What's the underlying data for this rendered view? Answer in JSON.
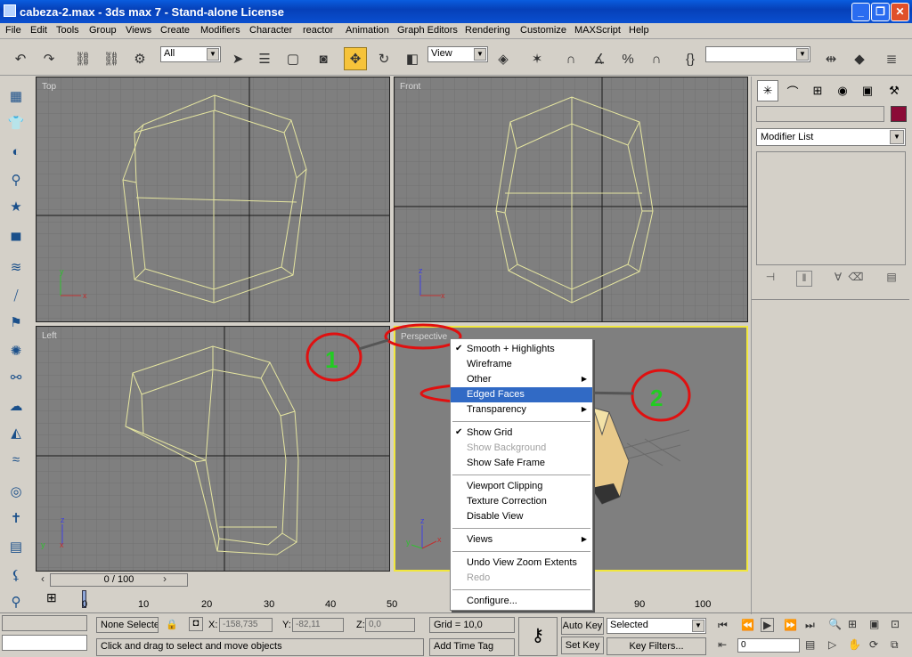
{
  "window": {
    "title": "cabeza-2.max - 3ds max 7 - Stand-alone License"
  },
  "menu": [
    "File",
    "Edit",
    "Tools",
    "Group",
    "Views",
    "Create",
    "Modifiers",
    "Character",
    "reactor",
    "Animation",
    "Graph Editors",
    "Rendering",
    "Customize",
    "MAXScript",
    "Help"
  ],
  "toolbar": {
    "selection_filter": "All",
    "ref_coord": "View"
  },
  "viewports": {
    "top": "Top",
    "front": "Front",
    "left": "Left",
    "perspective": "Perspective"
  },
  "axes": {
    "x": "x",
    "y": "y",
    "z": "z"
  },
  "context_menu": {
    "items": [
      {
        "label": "Smooth + Highlights",
        "checked": true
      },
      {
        "label": "Wireframe"
      },
      {
        "label": "Other",
        "submenu": true
      },
      {
        "label": "Edged Faces",
        "highlighted": true
      },
      {
        "label": "Transparency",
        "submenu": true
      },
      {
        "label": "Show Grid",
        "checked": true
      },
      {
        "label": "Show Background",
        "disabled": true
      },
      {
        "label": "Show Safe Frame"
      },
      {
        "label": "Viewport Clipping"
      },
      {
        "label": "Texture Correction"
      },
      {
        "label": "Disable View"
      },
      {
        "label": "Views",
        "submenu": true
      },
      {
        "label": "Undo View Zoom Extents"
      },
      {
        "label": "Redo",
        "disabled": true
      },
      {
        "label": "Configure..."
      }
    ]
  },
  "annotations": {
    "one": "1",
    "two": "2",
    "circle_color": "#e01010",
    "number_color": "#22cc22"
  },
  "command_panel": {
    "modifier_list": "Modifier List",
    "object_color": "#8b0b37"
  },
  "timeline": {
    "slider": "0 / 100",
    "ticks": [
      "0",
      "10",
      "20",
      "30",
      "40",
      "50",
      "90",
      "100"
    ]
  },
  "status": {
    "selection": "None Selecte",
    "x_label": "X:",
    "x_value": "-158,735",
    "y_label": "Y:",
    "y_value": "-82,11",
    "z_label": "Z:",
    "z_value": "0,0",
    "grid": "Grid = 10,0",
    "prompt": "Click and drag to select and move objects",
    "add_time_tag": "Add Time Tag",
    "auto_key": "Auto Key",
    "set_key": "Set Key",
    "key_mode": "Selected",
    "key_filters": "Key Filters...",
    "frame": "0"
  }
}
